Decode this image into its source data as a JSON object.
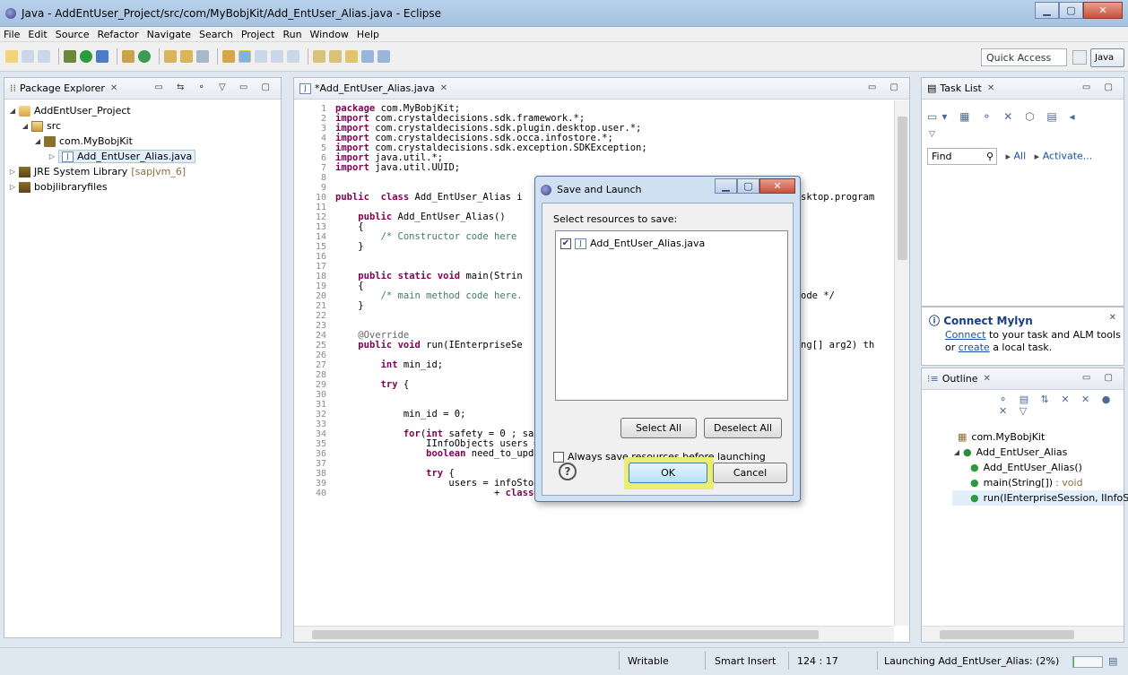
{
  "window": {
    "title": "Java - AddEntUser_Project/src/com/MyBobjKit/Add_EntUser_Alias.java - Eclipse"
  },
  "menu": [
    "File",
    "Edit",
    "Source",
    "Refactor",
    "Navigate",
    "Search",
    "Project",
    "Run",
    "Window",
    "Help"
  ],
  "toolbar": {
    "quick_access": "Quick Access",
    "perspective": "Java"
  },
  "package_explorer": {
    "title": "Package Explorer",
    "items": [
      {
        "label": "AddEntUser_Project"
      },
      {
        "label": "src"
      },
      {
        "label": "com.MyBobjKit"
      },
      {
        "label": "Add_EntUser_Alias.java"
      },
      {
        "label": "JRE System Library",
        "suffix": "[sapjvm_6]"
      },
      {
        "label": "bobjlibraryfiles"
      }
    ]
  },
  "editor": {
    "tab": "*Add_EntUser_Alias.java",
    "lines": [
      {
        "n": "1",
        "t": "package com.MyBobjKit;"
      },
      {
        "n": "2",
        "t": "import com.crystaldecisions.sdk.framework.*;"
      },
      {
        "n": "3",
        "t": "import com.crystaldecisions.sdk.plugin.desktop.user.*;"
      },
      {
        "n": "4",
        "t": "import com.crystaldecisions.sdk.occa.infostore.*;"
      },
      {
        "n": "5",
        "t": "import com.crystaldecisions.sdk.exception.SDKException;"
      },
      {
        "n": "6",
        "t": "import java.util.*;"
      },
      {
        "n": "7",
        "t": "import java.util.UUID;"
      },
      {
        "n": "8",
        "t": ""
      },
      {
        "n": "9",
        "t": ""
      },
      {
        "n": "10",
        "t": "public  class Add_EntUser_Alias i"
      },
      {
        "n": "11",
        "t": ""
      },
      {
        "n": "12",
        "t": "    public Add_EntUser_Alias()"
      },
      {
        "n": "13",
        "t": "    {"
      },
      {
        "n": "14",
        "t": "        /* Constructor code here "
      },
      {
        "n": "15",
        "t": "    }"
      },
      {
        "n": "16",
        "t": ""
      },
      {
        "n": "17",
        "t": ""
      },
      {
        "n": "18",
        "t": "    public static void main(Strin"
      },
      {
        "n": "19",
        "t": "    {"
      },
      {
        "n": "20",
        "t": "        /* main method code here."
      },
      {
        "n": "21",
        "t": "    }"
      },
      {
        "n": "22",
        "t": ""
      },
      {
        "n": "23",
        "t": ""
      },
      {
        "n": "24",
        "t": "    @Override"
      },
      {
        "n": "25",
        "t": "    public void run(IEnterpriseSe"
      },
      {
        "n": "26",
        "t": ""
      },
      {
        "n": "27",
        "t": "        int min_id;"
      },
      {
        "n": "28",
        "t": ""
      },
      {
        "n": "29",
        "t": "        try {"
      },
      {
        "n": "30",
        "t": ""
      },
      {
        "n": "31",
        "t": ""
      },
      {
        "n": "32",
        "t": "            min_id = 0;"
      },
      {
        "n": "33",
        "t": ""
      },
      {
        "n": "34",
        "t": "            for(int safety = 0 ; safety < 1000 ; safety++) {"
      },
      {
        "n": "35",
        "t": "                IInfoObjects users = null;"
      },
      {
        "n": "36",
        "t": "                boolean need_to_update = false;"
      },
      {
        "n": "37",
        "t": ""
      },
      {
        "n": "38",
        "t": "                try {"
      },
      {
        "n": "39",
        "t": "                    users = infoStore.query(\"SELECT TOP 100 STATIC \""
      },
      {
        "n": "40",
        "t": "                            + \" FROM CI_SYSTEMOBJECTS \""
      }
    ],
    "right_fragments": [
      {
        "line": "10",
        "t": "sktop.program"
      },
      {
        "line": "20",
        "t": "ode */"
      },
      {
        "line": "25",
        "t": "ng[] arg2) th"
      }
    ]
  },
  "task_list": {
    "title": "Task List",
    "find": "Find",
    "all": "All",
    "activate": "Activate...",
    "mylyn": {
      "heading": "Connect Mylyn",
      "connect": "Connect",
      "text1": "to your task and ALM tools",
      "text2": "or",
      "create": "create",
      "text3": "a local task."
    }
  },
  "outline": {
    "title": "Outline",
    "items": [
      {
        "label": "com.MyBobjKit",
        "detail": ""
      },
      {
        "label": "Add_EntUser_Alias",
        "detail": ""
      },
      {
        "label": "Add_EntUser_Alias()",
        "detail": ""
      },
      {
        "label": "main(String[])",
        "detail": ": void"
      },
      {
        "label": "run(IEnterpriseSession, IInfoS",
        "detail": ""
      }
    ]
  },
  "dialog": {
    "title": "Save and Launch",
    "prompt": "Select resources to save:",
    "resource": "Add_EntUser_Alias.java",
    "select_all": "Select All",
    "deselect_all": "Deselect All",
    "always_save": "Always save resources before launching",
    "ok": "OK",
    "cancel": "Cancel"
  },
  "status": {
    "writable": "Writable",
    "insert_mode": "Smart Insert",
    "position": "124 : 17",
    "launching": "Launching Add_EntUser_Alias: (2%)",
    "launching_progress": 0.02
  }
}
